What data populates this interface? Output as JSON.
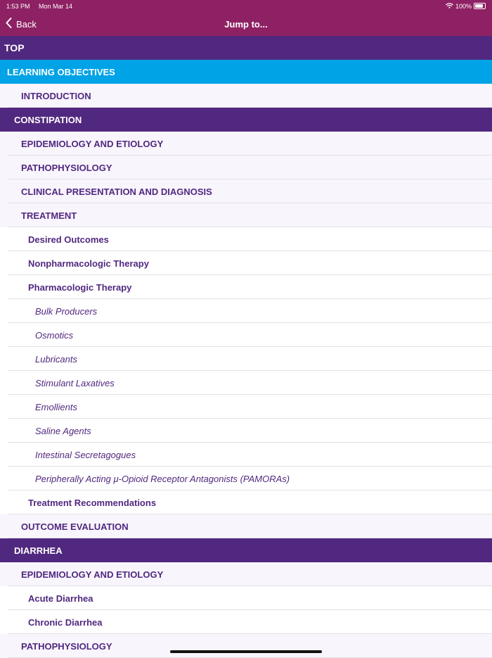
{
  "status": {
    "time": "1:53 PM",
    "date": "Mon Mar 14",
    "battery": "100%"
  },
  "nav": {
    "back_label": "Back",
    "title": "Jump to..."
  },
  "colors": {
    "nav": "#8e2163",
    "section": "#51287f",
    "objectives": "#00a3e6",
    "text": "#51287f"
  },
  "rows": [
    {
      "type": "top",
      "label": "TOP"
    },
    {
      "type": "lo",
      "label": "LEARNING OBJECTIVES"
    },
    {
      "type": "l2",
      "label": "INTRODUCTION"
    },
    {
      "type": "section",
      "label": "CONSTIPATION"
    },
    {
      "type": "l2",
      "label": "EPIDEMIOLOGY AND ETIOLOGY"
    },
    {
      "type": "l2",
      "label": "PATHOPHYSIOLOGY"
    },
    {
      "type": "l2",
      "label": "CLINICAL PRESENTATION AND DIAGNOSIS"
    },
    {
      "type": "l2",
      "label": "TREATMENT"
    },
    {
      "type": "l3",
      "label": "Desired Outcomes"
    },
    {
      "type": "l3",
      "label": "Nonpharmacologic Therapy"
    },
    {
      "type": "l3",
      "label": "Pharmacologic Therapy"
    },
    {
      "type": "l4",
      "label": "Bulk Producers"
    },
    {
      "type": "l4",
      "label": "Osmotics"
    },
    {
      "type": "l4",
      "label": "Lubricants"
    },
    {
      "type": "l4",
      "label": "Stimulant Laxatives"
    },
    {
      "type": "l4",
      "label": "Emollients"
    },
    {
      "type": "l4",
      "label": "Saline Agents"
    },
    {
      "type": "l4",
      "label": "Intestinal Secretagogues"
    },
    {
      "type": "l4",
      "label": "Peripherally Acting μ-Opioid Receptor Antagonists (PAMORAs)"
    },
    {
      "type": "l3",
      "label": "Treatment Recommendations"
    },
    {
      "type": "l2",
      "label": "OUTCOME EVALUATION"
    },
    {
      "type": "section",
      "label": "DIARRHEA"
    },
    {
      "type": "l2",
      "label": "EPIDEMIOLOGY AND ETIOLOGY"
    },
    {
      "type": "l3",
      "label": "Acute Diarrhea"
    },
    {
      "type": "l3",
      "label": "Chronic Diarrhea"
    },
    {
      "type": "l2",
      "label": "PATHOPHYSIOLOGY"
    }
  ]
}
